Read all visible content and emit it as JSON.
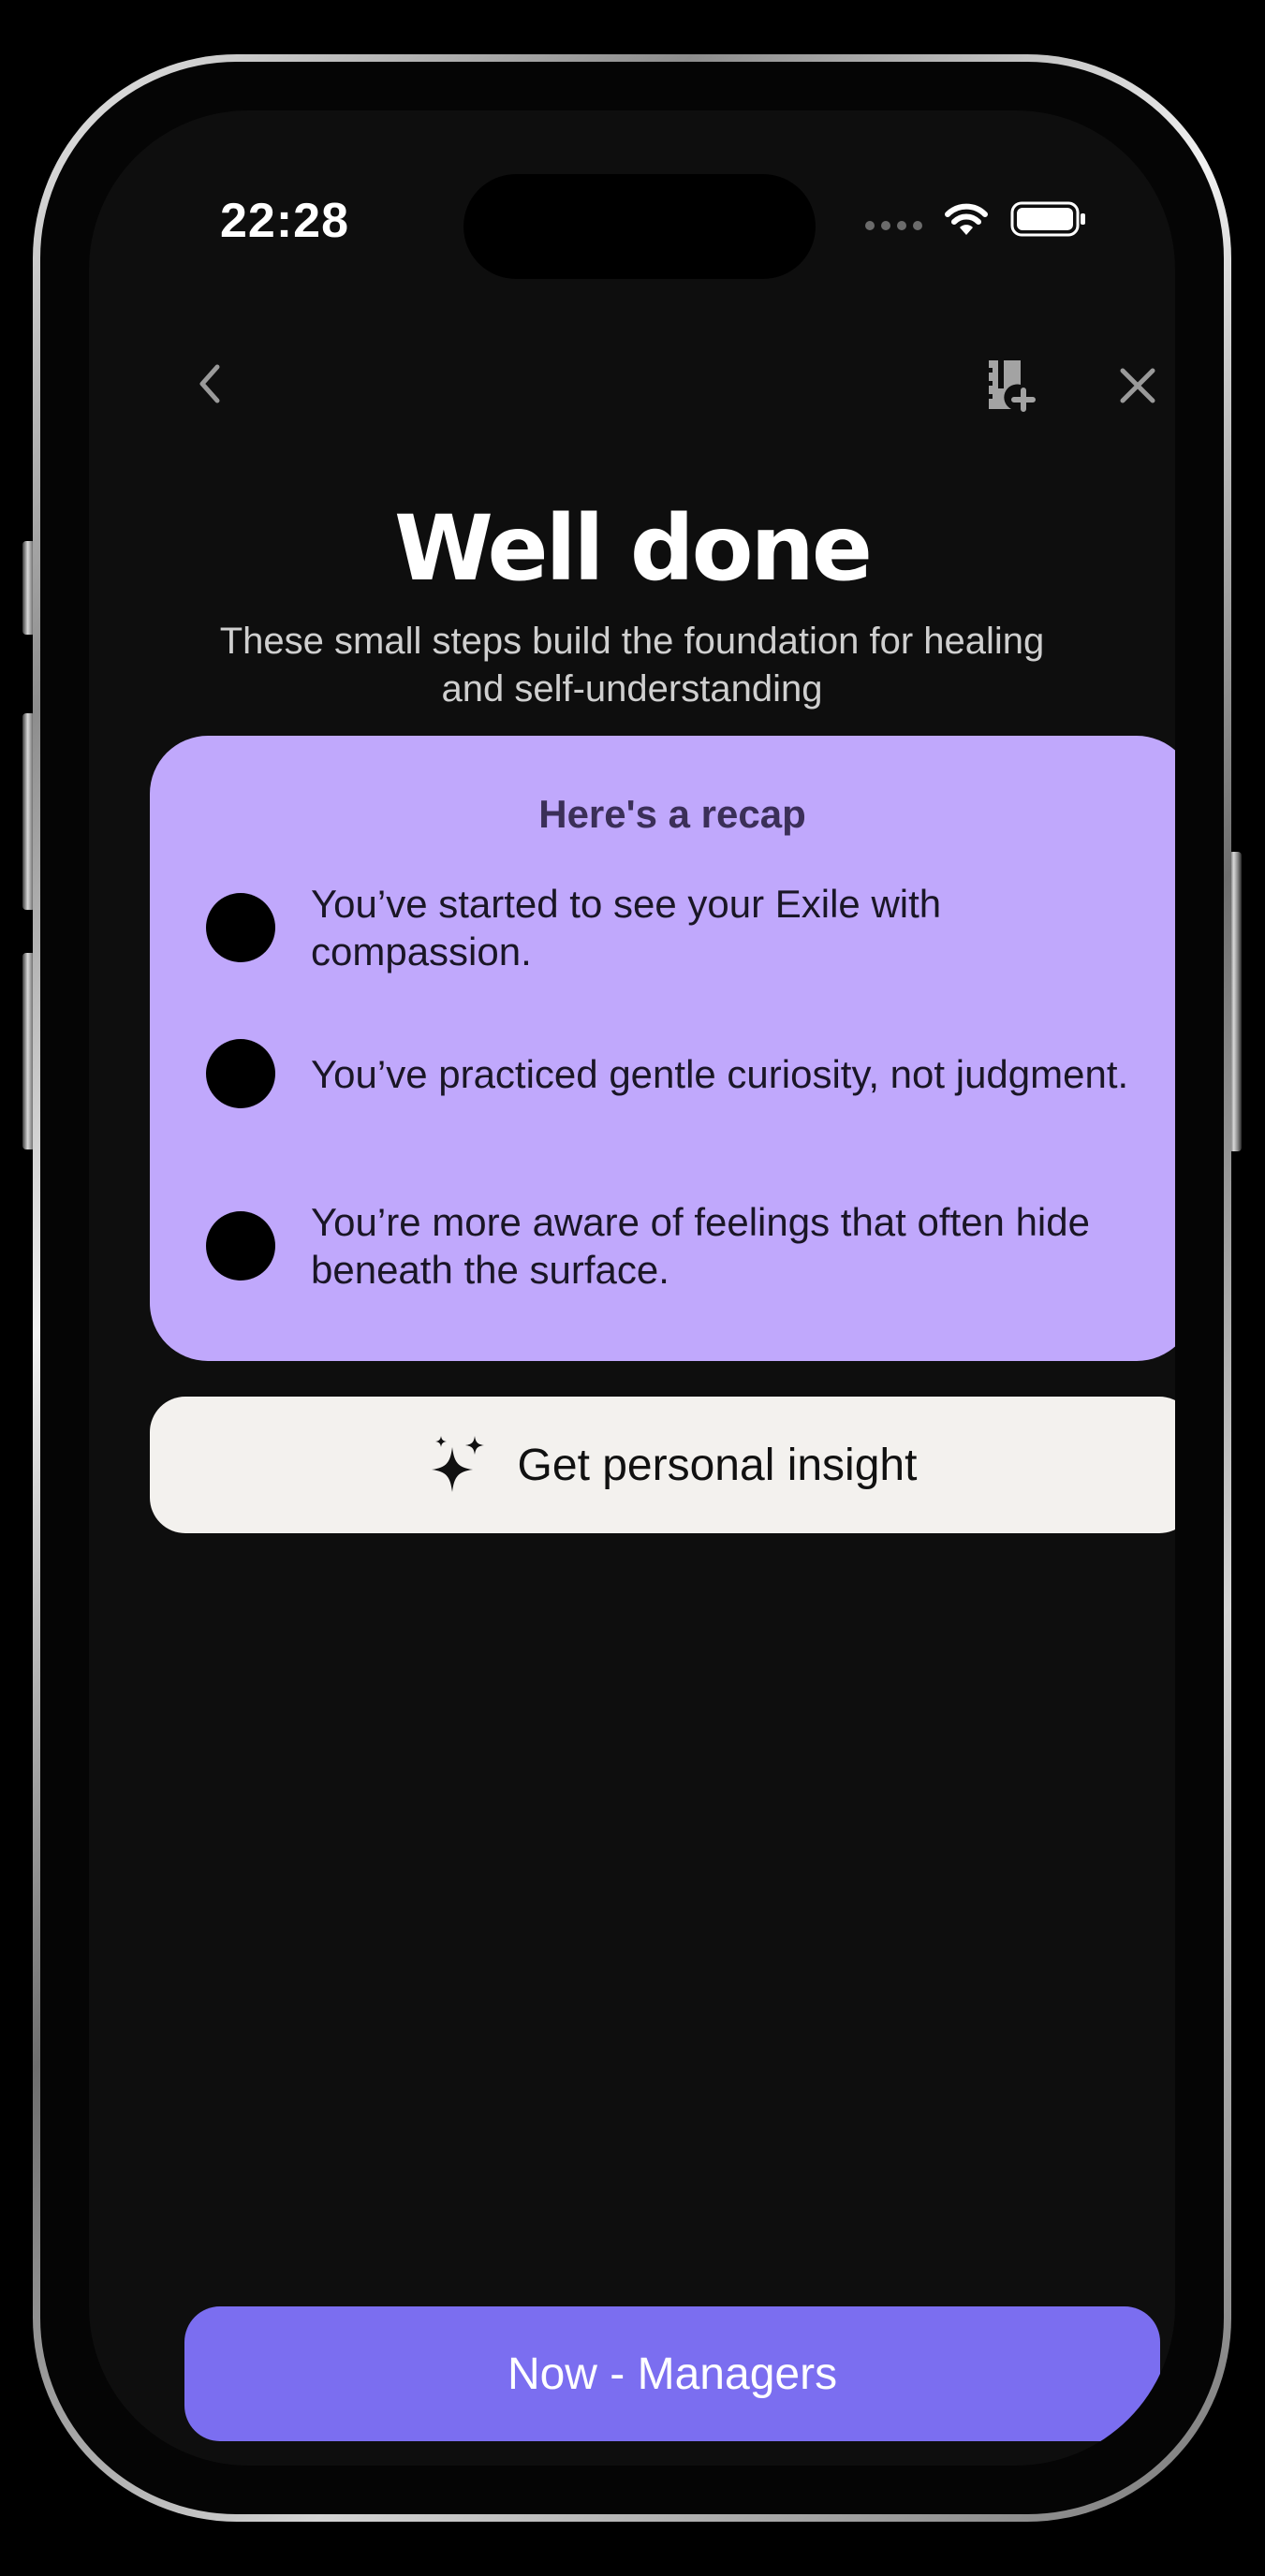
{
  "status_bar": {
    "time": "22:28"
  },
  "nav": {
    "back_icon": "chevron-left-icon",
    "journal_icon": "journal-add-icon",
    "close_icon": "close-icon"
  },
  "header": {
    "title": "Well done",
    "subtitle": "These small steps build the foundation for healing and self-understanding"
  },
  "recap": {
    "title": "Here's a recap",
    "items": [
      {
        "text": "You’ve started to see your Exile with compassion."
      },
      {
        "text": "You’ve practiced gentle curiosity, not judgment."
      },
      {
        "text": "You’re more aware of feelings that often hide beneath the surface."
      }
    ]
  },
  "insight_button": {
    "label": "Get personal insight",
    "icon": "sparkles-icon"
  },
  "cta": {
    "label": "Now - Managers"
  },
  "colors": {
    "background": "#0e0e0e",
    "card": "#c0a8fc",
    "insight_button": "#f3f1ee",
    "cta": "#7b6ef0"
  }
}
